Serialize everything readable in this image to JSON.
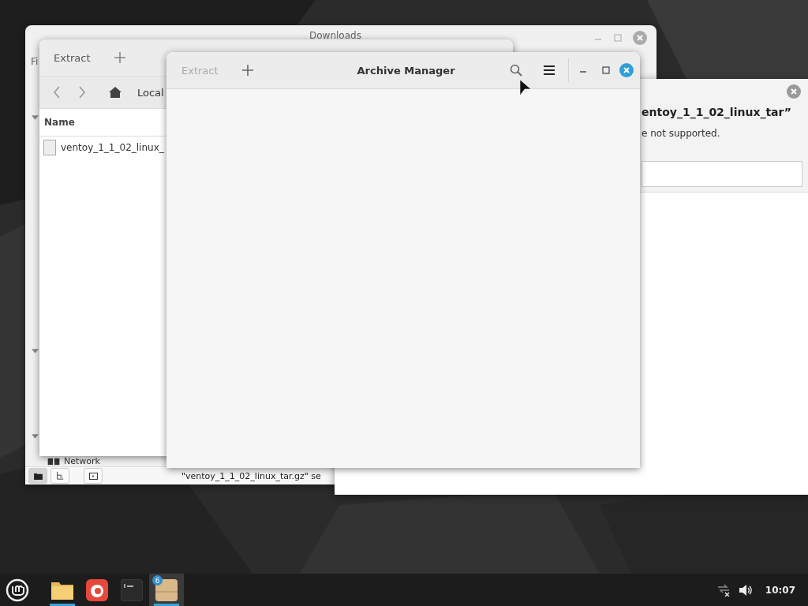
{
  "files_window": {
    "title": "Downloads",
    "menu_label": "Fi",
    "sidebar_place": "Network",
    "status": "\"ventoy_1_1_02_linux_tar.gz\" se",
    "view_buttons": [
      {
        "kind": "places",
        "selected": true
      },
      {
        "kind": "tree",
        "selected": false
      },
      {
        "kind": "sidebar",
        "selected": false
      }
    ]
  },
  "archive_window_back": {
    "extract_label": "Extract",
    "path_label": "Local",
    "column": "Name",
    "file": "ventoy_1_1_02_linux_"
  },
  "dialog": {
    "title": "entoy_1_1_02_linux_tar”",
    "message": "e not supported."
  },
  "archive_window": {
    "title": "Archive Manager",
    "extract": {
      "label": "Extract",
      "disabled": true
    }
  },
  "taskbar": {
    "apps": [
      {
        "kind": "files",
        "running": true,
        "selected": false
      },
      {
        "kind": "browser",
        "running": false,
        "selected": false
      },
      {
        "kind": "terminal",
        "running": false,
        "selected": false
      },
      {
        "kind": "archive",
        "running": true,
        "selected": true,
        "badge": "6"
      }
    ],
    "clock": "10:07"
  }
}
